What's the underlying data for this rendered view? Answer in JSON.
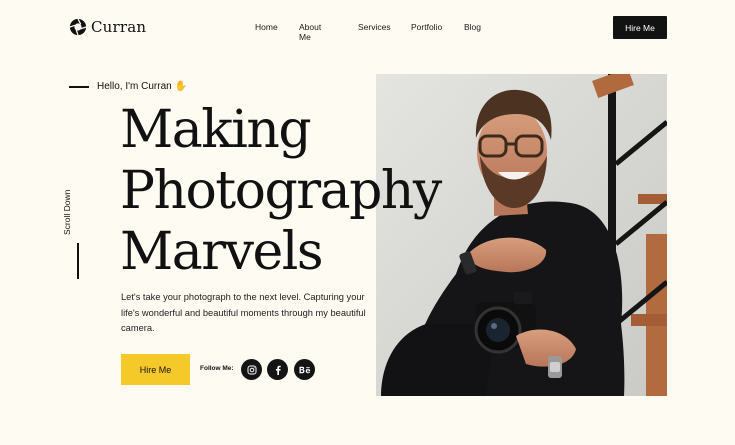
{
  "brand": {
    "name": "Curran",
    "icon": "camera-aperture-icon"
  },
  "nav": {
    "items": [
      "Home",
      "About Me",
      "Services",
      "Portfolio",
      "Blog"
    ]
  },
  "header": {
    "cta_label": "Hire Me"
  },
  "hero": {
    "greeting": "Hello, I'm Curran",
    "greeting_icon": "waving-hand-icon",
    "headline_lines": [
      "Making",
      "Photography",
      "Marvels"
    ],
    "scroll_label": "Scroll Down",
    "description": "Let's take your photograph to the next level. Capturing your life's wonderful and beautiful moments through my beautiful camera.",
    "cta_label": "Hire Me",
    "follow_label": "Follow Me:",
    "social": [
      {
        "icon": "instagram-icon",
        "glyph": "◎"
      },
      {
        "icon": "facebook-icon",
        "glyph": "f"
      },
      {
        "icon": "behance-icon",
        "glyph": "Bē"
      }
    ]
  },
  "colors": {
    "background": "#fdfbf2",
    "accent": "#f6c92a",
    "dark": "#121212"
  }
}
